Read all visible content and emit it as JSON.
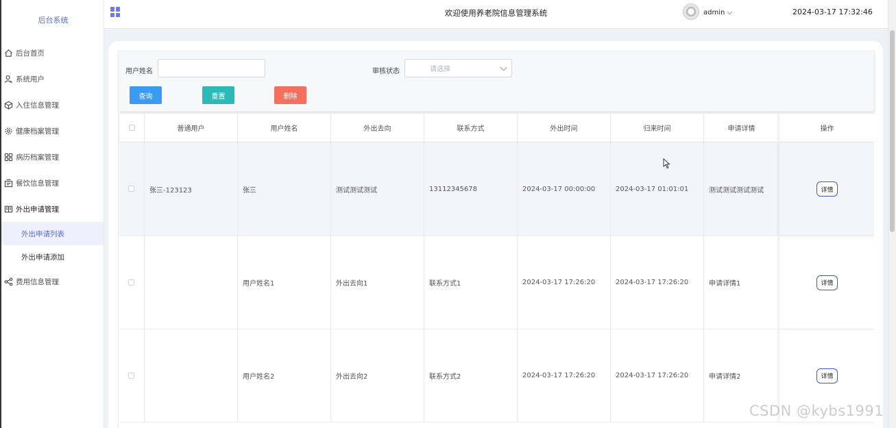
{
  "sidebar": {
    "brand": "后台系统",
    "items": [
      {
        "label": "后台首页",
        "icon": "home-icon"
      },
      {
        "label": "系统用户",
        "icon": "user-icon"
      },
      {
        "label": "入住信息管理",
        "icon": "box-icon"
      },
      {
        "label": "健康档案管理",
        "icon": "gear-icon"
      },
      {
        "label": "病历档案管理",
        "icon": "grid-icon"
      },
      {
        "label": "餐饮信息管理",
        "icon": "tray-icon"
      },
      {
        "label": "外出申请管理",
        "icon": "book-icon"
      }
    ],
    "sub_items": [
      {
        "label": "外出申请列表",
        "active": true
      },
      {
        "label": "外出申请添加",
        "active": false
      }
    ],
    "last_item": {
      "label": "费用信息管理",
      "icon": "share-icon"
    }
  },
  "header": {
    "title": "欢迎使用养老院信息管理系统",
    "user": "admin",
    "datetime": "2024-03-17 17:32:46"
  },
  "search": {
    "username_label": "用户姓名",
    "username_value": "",
    "status_label": "审核状态",
    "status_placeholder": "请选择",
    "query_button": "查询",
    "reset_button": "重置",
    "delete_button": "删除"
  },
  "table": {
    "columns": [
      "普通用户",
      "用户姓名",
      "外出去向",
      "联系方式",
      "外出时间",
      "归来时间",
      "申请详情",
      "操作"
    ],
    "action_label": "详情",
    "rows": [
      {
        "user": "张三-123123",
        "name": "张三",
        "destination": "测试测试测试",
        "contact": "13112345678",
        "out_time": "2024-03-17 00:00:00",
        "return_time": "2024-03-17 01:01:01",
        "detail": "测试测试测试测试"
      },
      {
        "user": "",
        "name": "用户姓名1",
        "destination": "外出去向1",
        "contact": "联系方式1",
        "out_time": "2024-03-17 17:26:20",
        "return_time": "2024-03-17 17:26:20",
        "detail": "申请详情1"
      },
      {
        "user": "",
        "name": "用户姓名2",
        "destination": "外出去向2",
        "contact": "联系方式2",
        "out_time": "2024-03-17 17:26:20",
        "return_time": "2024-03-17 17:26:20",
        "detail": "申请详情2"
      }
    ]
  },
  "watermark": "CSDN @kybs1991",
  "colors": {
    "accent": "#5b6dd6",
    "query": "#3a9bf2",
    "reset": "#2bbab8",
    "delete": "#f56f5e"
  }
}
